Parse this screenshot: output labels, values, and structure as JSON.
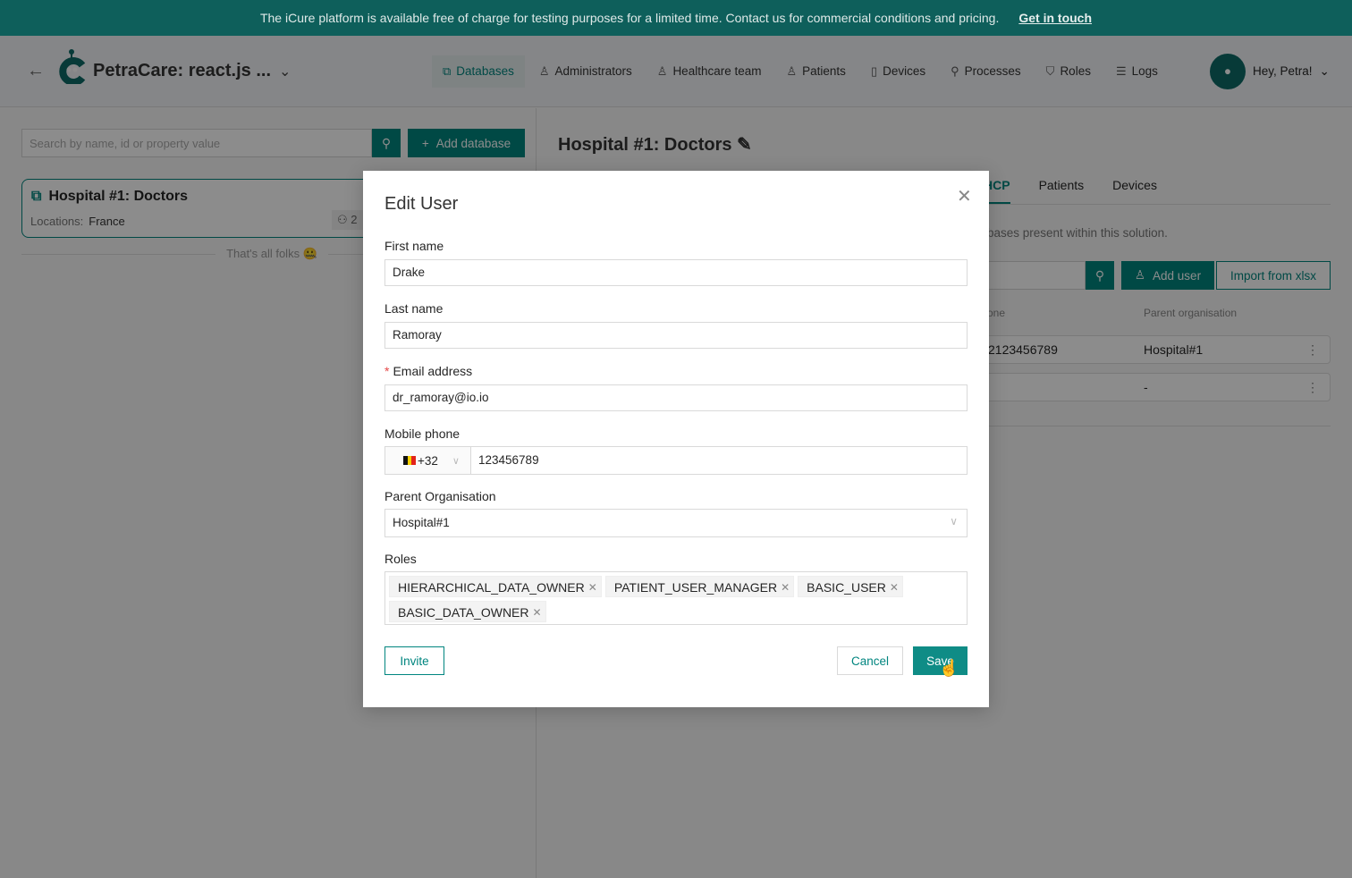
{
  "banner": {
    "text": "The iCure platform is available free of charge for testing purposes for a limited time. Contact us for commercial conditions and pricing.",
    "link": "Get in touch"
  },
  "header": {
    "title": "PetraCare: react.js ...",
    "nav": [
      {
        "label": "Databases",
        "icon": "database-icon",
        "active": true
      },
      {
        "label": "Administrators",
        "icon": "admin-icon"
      },
      {
        "label": "Healthcare team",
        "icon": "doctor-icon"
      },
      {
        "label": "Patients",
        "icon": "person-icon"
      },
      {
        "label": "Devices",
        "icon": "device-icon"
      },
      {
        "label": "Processes",
        "icon": "wrench-icon"
      },
      {
        "label": "Roles",
        "icon": "shield-icon"
      },
      {
        "label": "Logs",
        "icon": "list-icon"
      }
    ],
    "greeting": "Hey, Petra!"
  },
  "left": {
    "search_placeholder": "Search by name, id or property value",
    "add_database": "Add database",
    "card": {
      "name": "Hospital #1: Doctors",
      "locations_label": "Locations:",
      "locations": "France",
      "count": "2"
    },
    "end_text": "That's all folks 🤐"
  },
  "right": {
    "title": "Hospital #1: Doctors",
    "tabs": [
      "HCP",
      "Patients",
      "Devices"
    ],
    "description": "bases present within this solution.",
    "add_user": "Add user",
    "import": "Import from xlsx",
    "columns": [
      "one",
      "Parent organisation"
    ],
    "rows": [
      {
        "phone": "2123456789",
        "parent": "Hospital#1"
      },
      {
        "phone": "",
        "parent": "-"
      }
    ]
  },
  "modal": {
    "title": "Edit User",
    "first_name_label": "First name",
    "first_name": "Drake",
    "last_name_label": "Last name",
    "last_name": "Ramoray",
    "email_label": "Email address",
    "email": "dr_ramoray@io.io",
    "phone_label": "Mobile phone",
    "country_code": "+32",
    "phone": "123456789",
    "parent_label": "Parent Organisation",
    "parent": "Hospital#1",
    "roles_label": "Roles",
    "roles": [
      "HIERARCHICAL_DATA_OWNER",
      "PATIENT_USER_MANAGER",
      "BASIC_USER",
      "BASIC_DATA_OWNER"
    ],
    "invite": "Invite",
    "cancel": "Cancel",
    "save": "Save"
  },
  "colors": {
    "accent": "#00857f",
    "banner": "#0e5f5b"
  }
}
